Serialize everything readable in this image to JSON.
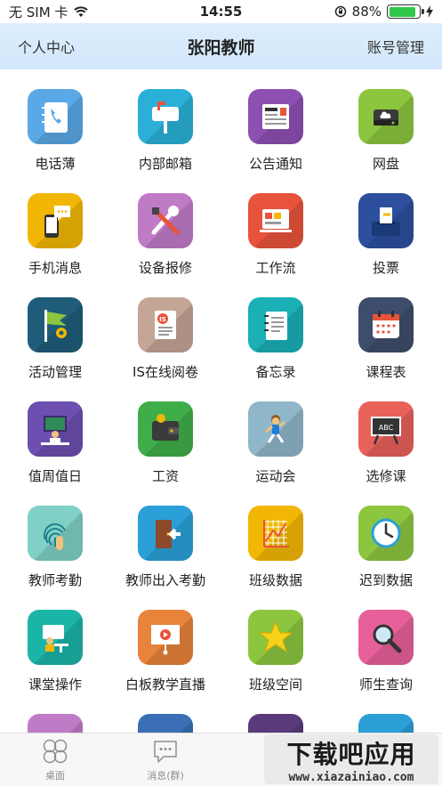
{
  "status_bar": {
    "carrier": "无 SIM 卡",
    "time": "14:55",
    "battery_percent": "88%",
    "battery_level": 0.88
  },
  "nav": {
    "left": "个人中心",
    "title": "张阳教师",
    "right": "账号管理"
  },
  "apps": [
    {
      "label": "电话薄",
      "icon": "phonebook-icon",
      "color": "#5aa9e6"
    },
    {
      "label": "内部邮箱",
      "icon": "mailbox-icon",
      "color": "#2ab0d8"
    },
    {
      "label": "公告通知",
      "icon": "news-icon",
      "color": "#8e4fb3"
    },
    {
      "label": "网盘",
      "icon": "disk-icon",
      "color": "#8cc63f"
    },
    {
      "label": "手机消息",
      "icon": "mobile-message-icon",
      "color": "#f2b705"
    },
    {
      "label": "设备报修",
      "icon": "repair-tools-icon",
      "color": "#c07bc7"
    },
    {
      "label": "工作流",
      "icon": "workflow-icon",
      "color": "#e8533b"
    },
    {
      "label": "投票",
      "icon": "vote-icon",
      "color": "#2c4f9e"
    },
    {
      "label": "活动管理",
      "icon": "activity-flag-icon",
      "color": "#1f5c7a"
    },
    {
      "label": "IS在线阅卷",
      "icon": "exam-paper-icon",
      "color": "#c5a596"
    },
    {
      "label": "备忘录",
      "icon": "memo-icon",
      "color": "#1ab0b6"
    },
    {
      "label": "课程表",
      "icon": "calendar-icon",
      "color": "#3e4d6b"
    },
    {
      "label": "值周值日",
      "icon": "duty-icon",
      "color": "#6c4fb0"
    },
    {
      "label": "工资",
      "icon": "wallet-icon",
      "color": "#3fae49"
    },
    {
      "label": "运动会",
      "icon": "sports-icon",
      "color": "#8fb6c9"
    },
    {
      "label": "选修课",
      "icon": "blackboard-icon",
      "color": "#e8615a"
    },
    {
      "label": "教师考勤",
      "icon": "fingerprint-icon",
      "color": "#7fd0c6"
    },
    {
      "label": "教师出入考勤",
      "icon": "door-icon",
      "color": "#2a9fd8"
    },
    {
      "label": "班级数据",
      "icon": "chart-grid-icon",
      "color": "#f2b705"
    },
    {
      "label": "迟到数据",
      "icon": "clock-icon",
      "color": "#8cc63f"
    },
    {
      "label": "课堂操作",
      "icon": "classroom-icon",
      "color": "#1bb5a8"
    },
    {
      "label": "白板教学直播",
      "icon": "whiteboard-video-icon",
      "color": "#e8833b"
    },
    {
      "label": "班级空间",
      "icon": "star-icon",
      "color": "#8cc63f"
    },
    {
      "label": "师生查询",
      "icon": "search-icon",
      "color": "#e8609a"
    },
    {
      "label": "",
      "icon": "partial-app-icon",
      "color": "#c07bc7"
    },
    {
      "label": "",
      "icon": "partial-app-icon",
      "color": "#3a6fb5"
    },
    {
      "label": "",
      "icon": "partial-app-icon",
      "color": "#5a3a7a"
    },
    {
      "label": "",
      "icon": "partial-app-icon",
      "color": "#2a9fd8"
    }
  ],
  "tabs": [
    {
      "label": "桌面",
      "icon": "desktop-grid-icon"
    },
    {
      "label": "消息(群)",
      "icon": "chat-bubble-icon"
    },
    {
      "label": "",
      "icon": ""
    },
    {
      "label": "",
      "icon": ""
    }
  ],
  "watermark": {
    "main": "下载吧应用",
    "sub": "www.xiazainiao.com"
  }
}
